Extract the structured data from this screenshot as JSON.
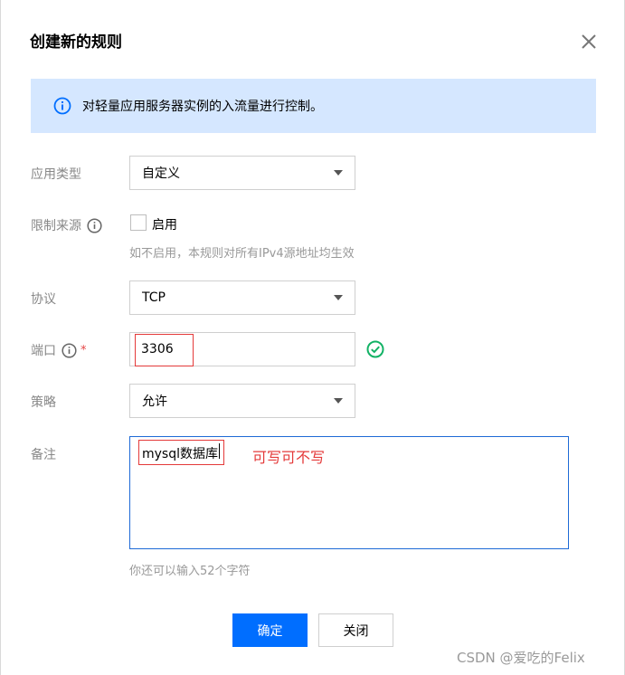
{
  "dialog": {
    "title": "创建新的规则",
    "notice": "对轻量应用服务器实例的入流量进行控制。"
  },
  "fields": {
    "app_type": {
      "label": "应用类型",
      "value": "自定义"
    },
    "source_limit": {
      "label": "限制来源",
      "checkbox_label": "启用",
      "checked": false,
      "hint": "如不启用，本规则对所有IPv4源地址均生效"
    },
    "protocol": {
      "label": "协议",
      "value": "TCP"
    },
    "port": {
      "label": "端口",
      "required_mark": "*",
      "value": "3306"
    },
    "policy": {
      "label": "策略",
      "value": "允许"
    },
    "remark": {
      "label": "备注",
      "value": "mysql数据库",
      "remaining_hint": "你还可以输入52个字符"
    }
  },
  "annotation": {
    "text": "可写可不写",
    "color": "#e43a3a"
  },
  "buttons": {
    "confirm": "确定",
    "close": "关闭"
  },
  "watermark": "CSDN @爱吃的Felix",
  "colors": {
    "primary": "#006eff",
    "notice_bg": "#d5e7ff",
    "success": "#12b265",
    "annotation_red": "#e43a3a"
  },
  "icons": {
    "close": "close-icon",
    "info": "info-icon",
    "success": "check-circle-icon",
    "caret": "chevron-down-icon"
  }
}
